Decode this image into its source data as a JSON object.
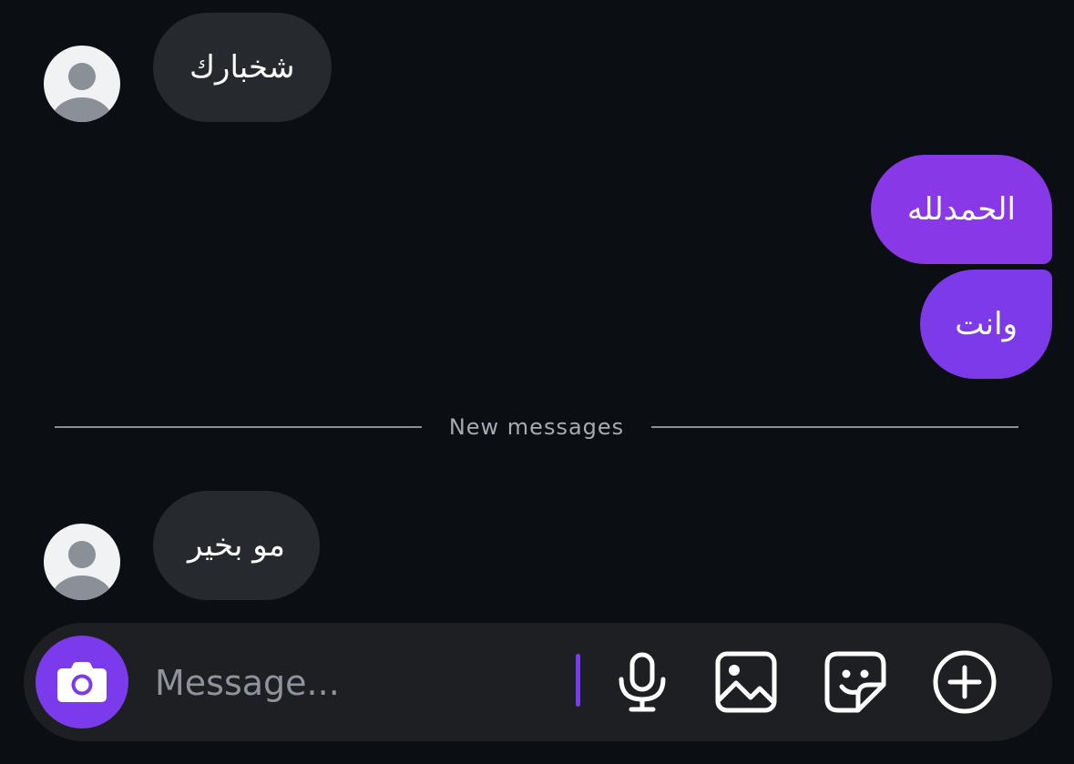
{
  "messages": [
    {
      "direction": "incoming",
      "text": "شخبارك"
    },
    {
      "direction": "outgoing",
      "text": "الحمدلله"
    },
    {
      "direction": "outgoing",
      "text": "وانت"
    },
    {
      "direction": "incoming",
      "text": "مو بخير"
    }
  ],
  "divider": {
    "label": "New messages"
  },
  "composer": {
    "placeholder": "Message..."
  },
  "icons": {
    "avatar": "person-icon",
    "camera": "camera-icon",
    "mic": "microphone-icon",
    "gallery": "image-icon",
    "sticker": "sticker-icon",
    "plus": "plus-circle-icon"
  },
  "colors": {
    "background": "#0b0e13",
    "incoming_bubble": "#26292e",
    "outgoing_bubble": "#7c3aed",
    "accent": "#7c3aed"
  }
}
